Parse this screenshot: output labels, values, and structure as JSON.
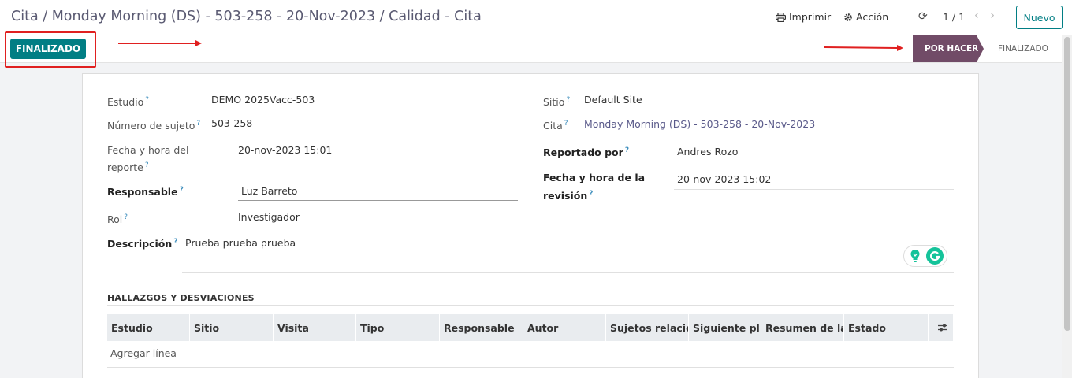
{
  "header": {
    "breadcrumb": "Cita / Monday Morning (DS) - 503-258 - 20-Nov-2023 / Calidad - Cita",
    "print_label": "Imprimir",
    "action_label": "Acción",
    "pager": "1 / 1",
    "new_label": "Nuevo"
  },
  "statusbar": {
    "action_button": "FINALIZADO",
    "stages": [
      {
        "label": "POR HACER",
        "active": true
      },
      {
        "label": "FINALIZADO",
        "active": false
      }
    ],
    "active_color": "#714b67",
    "button_color": "#017e84",
    "annotation_color": "#e02020"
  },
  "form": {
    "estudio": {
      "label": "Estudio",
      "value": "DEMO 2025Vacc-503"
    },
    "numero_sujeto": {
      "label": "Número de sujeto",
      "value": "503-258"
    },
    "fecha_reporte": {
      "label_line1": "Fecha y hora del",
      "label_line2": "reporte",
      "value": "20-nov-2023 15:01"
    },
    "responsable": {
      "label": "Responsable",
      "value": "Luz Barreto"
    },
    "rol": {
      "label": "Rol",
      "value": "Investigador"
    },
    "descripcion": {
      "label": "Descripción",
      "value": "Prueba prueba prueba"
    },
    "sitio": {
      "label": "Sitio",
      "value": "Default Site"
    },
    "cita": {
      "label": "Cita",
      "value": "Monday Morning (DS) - 503-258 - 20-Nov-2023"
    },
    "reportado_por": {
      "label": "Reportado por",
      "value": "Andres Rozo"
    },
    "fecha_revision": {
      "label_line1": "Fecha y hora de la",
      "label_line2": "revisión",
      "value": "20-nov-2023 15:02"
    },
    "hint": "?"
  },
  "findings": {
    "title": "HALLAZGOS Y DESVIACIONES",
    "columns": [
      "Estudio",
      "Sitio",
      "Visita",
      "Tipo",
      "Responsable",
      "Autor",
      "Sujetos relacio...",
      "Siguiente pl...",
      "Resumen de la...",
      "Estado"
    ],
    "add_line": "Agregar línea"
  }
}
